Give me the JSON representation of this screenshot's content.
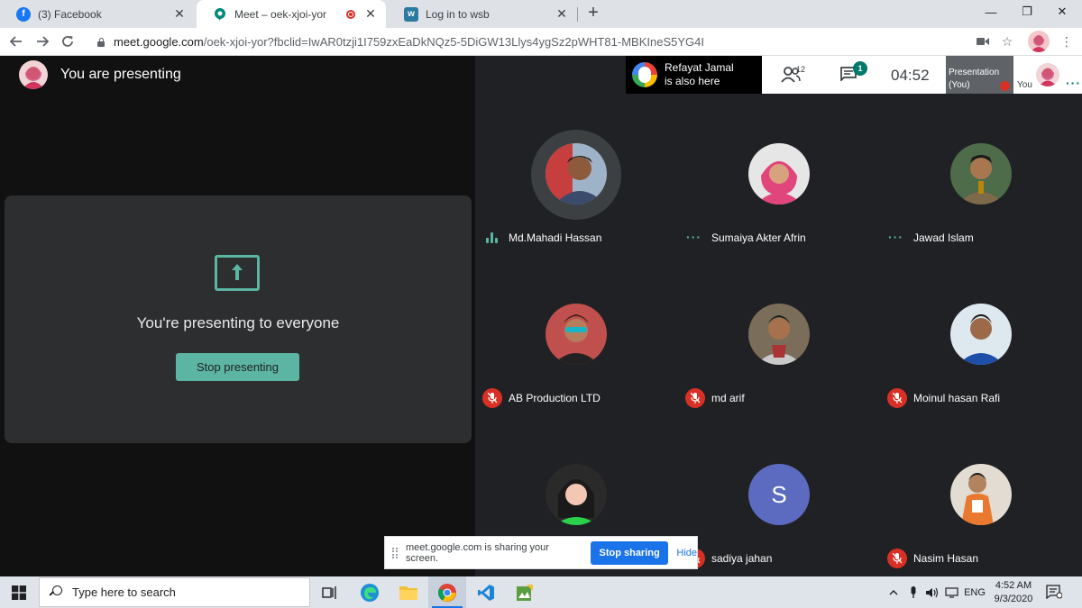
{
  "browser": {
    "tabs": [
      {
        "title": "(3) Facebook",
        "icon": "facebook-icon"
      },
      {
        "title": "Meet – oek-xjoi-yor",
        "icon": "meet-icon",
        "active": true
      },
      {
        "title": "Log in to wsb",
        "icon": "wsb-icon"
      }
    ],
    "url_domain": "meet.google.com",
    "url_path": "/oek-xjoi-yor?fbclid=IwAR0tzji1I759zxEaDkNQz5-5DiGW13Llys4ygSz2pWHT81-MBKIneS5YG4I"
  },
  "meet": {
    "presenting_title": "You are presenting",
    "present_message": "You're presenting to everyone",
    "stop_presenting_label": "Stop presenting",
    "toast_line1": "Refayat Jamal",
    "toast_line2": "is also here",
    "people_count": "12",
    "chat_badge": "1",
    "clock": "04:52",
    "self_tile_line1": "Presentation",
    "self_tile_line2": "(You)",
    "you_label": "You",
    "participants": [
      {
        "name": "Md.Mahadi Hassan",
        "status": "speaking"
      },
      {
        "name": "Sumaiya Akter Afrin",
        "status": "active"
      },
      {
        "name": "Jawad Islam",
        "status": "active"
      },
      {
        "name": "AB Production LTD",
        "status": "muted"
      },
      {
        "name": "md arif",
        "status": "muted"
      },
      {
        "name": "Moinul hasan Rafi",
        "status": "muted"
      },
      {
        "name": "",
        "status": "muted"
      },
      {
        "name": "sadiya jahan",
        "status": "muted",
        "initial": "S"
      },
      {
        "name": "Nasim Hasan",
        "status": "muted"
      }
    ],
    "share_text": "meet.google.com is sharing your screen.",
    "stop_sharing_label": "Stop sharing",
    "hide_label": "Hide"
  },
  "taskbar": {
    "search_placeholder": "Type here to search",
    "language": "ENG",
    "time": "4:52 AM",
    "date": "9/3/2020"
  },
  "colors": {
    "accent_teal": "#5bb5a2",
    "meet_green": "#00796b",
    "mute_red": "#d93025",
    "chrome_blue": "#1a73e8"
  }
}
